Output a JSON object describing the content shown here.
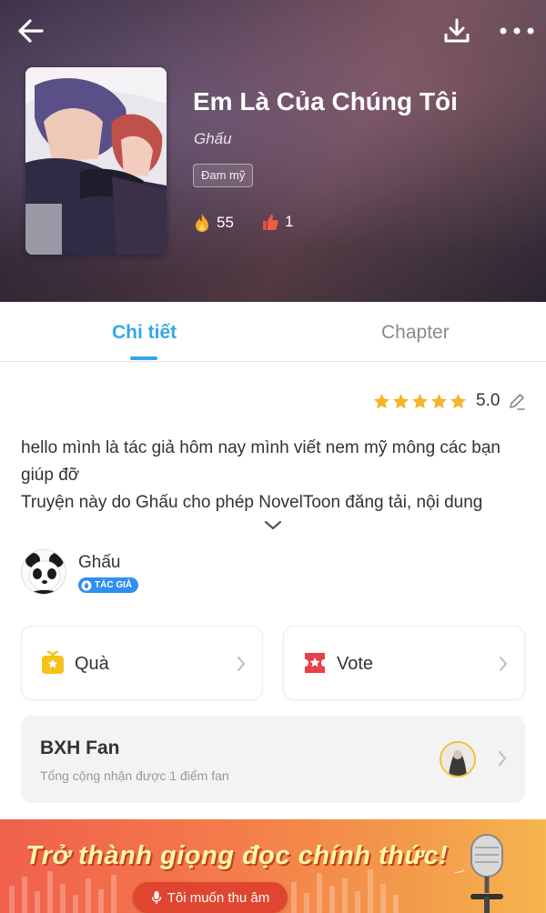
{
  "book": {
    "title": "Em Là Của Chúng Tôi",
    "author": "Ghấu",
    "genre": "Đam mỹ",
    "fire_count": "55",
    "like_count": "1"
  },
  "tabs": [
    {
      "label": "Chi tiết",
      "active": true
    },
    {
      "label": "Chapter",
      "active": false
    }
  ],
  "rating": {
    "value": "5.0",
    "stars": 5
  },
  "description": {
    "line1": "hello mình là tác giả  hôm nay mình viết nem mỹ mông các bạn giúp đỡ",
    "line2": "Truyện này do Ghấu cho phép NovelToon đăng tải, nội dung"
  },
  "author_block": {
    "name": "Ghấu",
    "badge": "TÁC GIẢ"
  },
  "actions": {
    "gift_label": "Quà",
    "vote_label": "Vote"
  },
  "fan": {
    "title": "BXH Fan",
    "subtitle": "Tổng cộng nhận được 1 điểm fan"
  },
  "banner": {
    "headline": "Trở thành giọng đọc chính thức!",
    "button_label": "Tôi muốn thu âm"
  },
  "colors": {
    "accent": "#35a7e6",
    "star": "#f5b42a",
    "badge": "#2e8ff0",
    "banner": "#f47a4b"
  }
}
